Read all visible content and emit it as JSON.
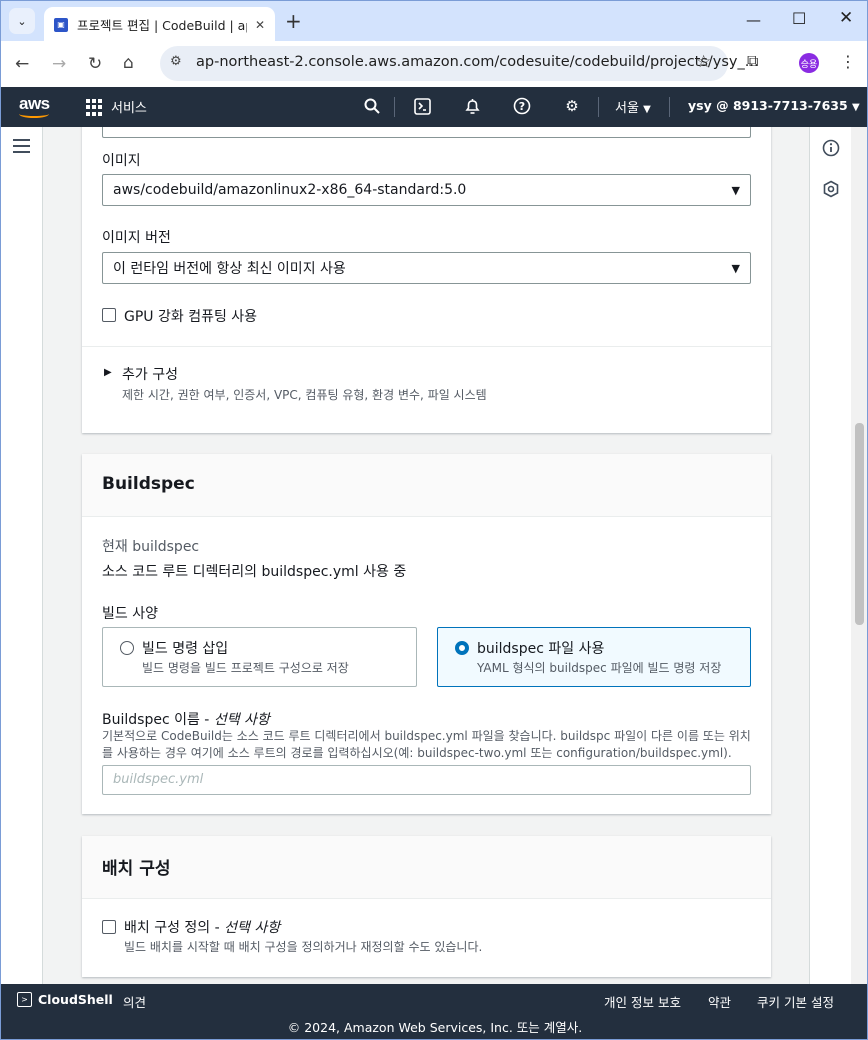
{
  "browser": {
    "tab_title": "프로젝트 편집 | CodeBuild | ap",
    "url": "ap-northeast-2.console.aws.amazon.com/codesuite/codebuild/projects/ysy_...",
    "profile_initials": "승용"
  },
  "aws_nav": {
    "logo": "aws",
    "services_label": "서비스",
    "region": "서울",
    "account": "ysy @ 8913-7713-7635"
  },
  "environment": {
    "image_label": "이미지",
    "image_value": "aws/codebuild/amazonlinux2-x86_64-standard:5.0",
    "image_version_label": "이미지 버전",
    "image_version_value": "이 런타임 버전에 항상 최신 이미지 사용",
    "gpu_label": "GPU 강화 컴퓨팅 사용",
    "gpu_checked": false,
    "additional_title": "추가 구성",
    "additional_desc": "제한 시간, 권한 여부, 인증서, VPC, 컴퓨팅 유형, 환경 변수, 파일 시스템"
  },
  "buildspec": {
    "header": "Buildspec",
    "current_label": "현재 buildspec",
    "current_value": "소스 코드 루트 디렉터리의 buildspec.yml 사용 중",
    "build_spec_label": "빌드 사양",
    "options": [
      {
        "title": "빌드 명령 삽입",
        "desc": "빌드 명령을 빌드 프로젝트 구성으로 저장",
        "selected": false
      },
      {
        "title": "buildspec 파일 사용",
        "desc": "YAML 형식의 buildspec 파일에 빌드 명령 저장",
        "selected": true
      }
    ],
    "name_label": "Buildspec 이름 - ",
    "name_optional": "선택 사항",
    "name_desc": "기본적으로 CodeBuild는 소스 코드 루트 디렉터리에서 buildspec.yml 파일을 찾습니다. buildspc 파일이 다른 이름 또는 위치를 사용하는 경우 여기에 소스 루트의 경로를 입력하십시오(예: buildspec-two.yml 또는 configuration/buildspec.yml).",
    "name_placeholder": "buildspec.yml"
  },
  "batch": {
    "header": "배치 구성",
    "checkbox_label": "배치 구성 정의 - ",
    "checkbox_optional": "선택 사항",
    "checkbox_desc": "빌드 배치를 시작할 때 배치 구성을 정의하거나 재정의할 수도 있습니다."
  },
  "footer": {
    "cloudshell": "CloudShell",
    "feedback": "의견",
    "privacy": "개인 정보 보호",
    "terms": "약관",
    "cookies": "쿠키 기본 설정",
    "copyright": "© 2024, Amazon Web Services, Inc. 또는 계열사."
  }
}
